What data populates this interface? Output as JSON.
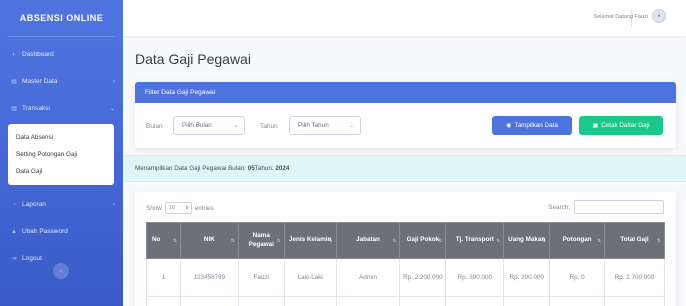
{
  "sidebar": {
    "brand": "ABSENSI ONLINE",
    "items": [
      {
        "label": "Dashboard",
        "icon": "gauge-icon"
      },
      {
        "label": "Master Data",
        "icon": "folder-icon"
      },
      {
        "label": "Transaksi",
        "icon": "folder-icon"
      },
      {
        "label": "Laporan",
        "icon": "chart-icon"
      },
      {
        "label": "Ubah Password",
        "icon": "lock-icon"
      },
      {
        "label": "Logout",
        "icon": "logout-icon"
      }
    ],
    "submenu": [
      "Data Absensi",
      "Setting Potongan Gaji",
      "Data Gaji"
    ]
  },
  "topbar": {
    "greeting": "Selamat Datang Fauzi"
  },
  "page": {
    "title": "Data Gaji Pegawai"
  },
  "filter": {
    "header": "Filter Data Gaji Pegawai",
    "bulan_label": "Bulan",
    "bulan_value": "Pilih Bulan",
    "tahun_label": "Tahun",
    "tahun_value": "Pilih Tahun",
    "btn_show": "Tampilkan Data",
    "btn_print": "Cetak Daftar Gaji"
  },
  "alert": {
    "prefix": "Menampilkan Data Gaji Pegawai Bulan: ",
    "month": "05",
    "mid": " Tahun: ",
    "year": "2024"
  },
  "table_controls": {
    "show_label": "Show",
    "show_value": "10",
    "entries_label": "entries",
    "search_label": "Search:"
  },
  "table": {
    "headers": [
      "No",
      "NIK",
      "Nama Pegawai",
      "Jenis Kelamin",
      "Jabatan",
      "Gaji Pokok",
      "Tj. Transport",
      "Uang Makan",
      "Potongan",
      "Total Gaji"
    ],
    "rows": [
      [
        "1",
        "123456789",
        "Fauzi",
        "Laki-Laki",
        "Admin",
        "Rp. 2.200.000",
        "Rp. 300.000",
        "Rp. 200.000",
        "Rp. 0",
        "Rp. 2.700.000"
      ]
    ]
  },
  "colors": {
    "primary": "#4e73df",
    "success": "#1cc88a",
    "info_bg": "#dff6f8",
    "table_head": "#6e7079"
  }
}
